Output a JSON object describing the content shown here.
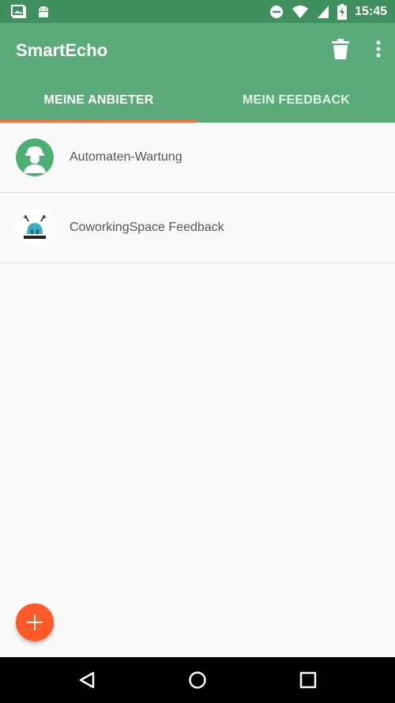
{
  "status_bar": {
    "time": "15:45",
    "icons": [
      "photo-notification-icon",
      "android-icon",
      "do-not-disturb-icon",
      "wifi-icon",
      "signal-icon",
      "battery-charging-icon"
    ]
  },
  "app_bar": {
    "title": "SmartEcho",
    "actions": [
      "trash-icon",
      "more-vert-icon"
    ]
  },
  "tabs": [
    {
      "label": "MEINE ANBIETER",
      "active": true
    },
    {
      "label": "MEIN FEEDBACK",
      "active": false
    }
  ],
  "list": {
    "items": [
      {
        "label": "Automaten-Wartung",
        "avatar": "technician-avatar"
      },
      {
        "label": "CoworkingSpace Feedback",
        "avatar": "coworking-logo"
      }
    ]
  },
  "colors": {
    "status_bar": "#3f8f5f",
    "primary": "#5aab79",
    "accent": "#ff6f3d",
    "fab": "#ff5a28"
  },
  "fab": {
    "icon": "plus-icon"
  },
  "nav_bar": {
    "icons": [
      "back-icon",
      "home-icon",
      "recents-icon"
    ]
  }
}
